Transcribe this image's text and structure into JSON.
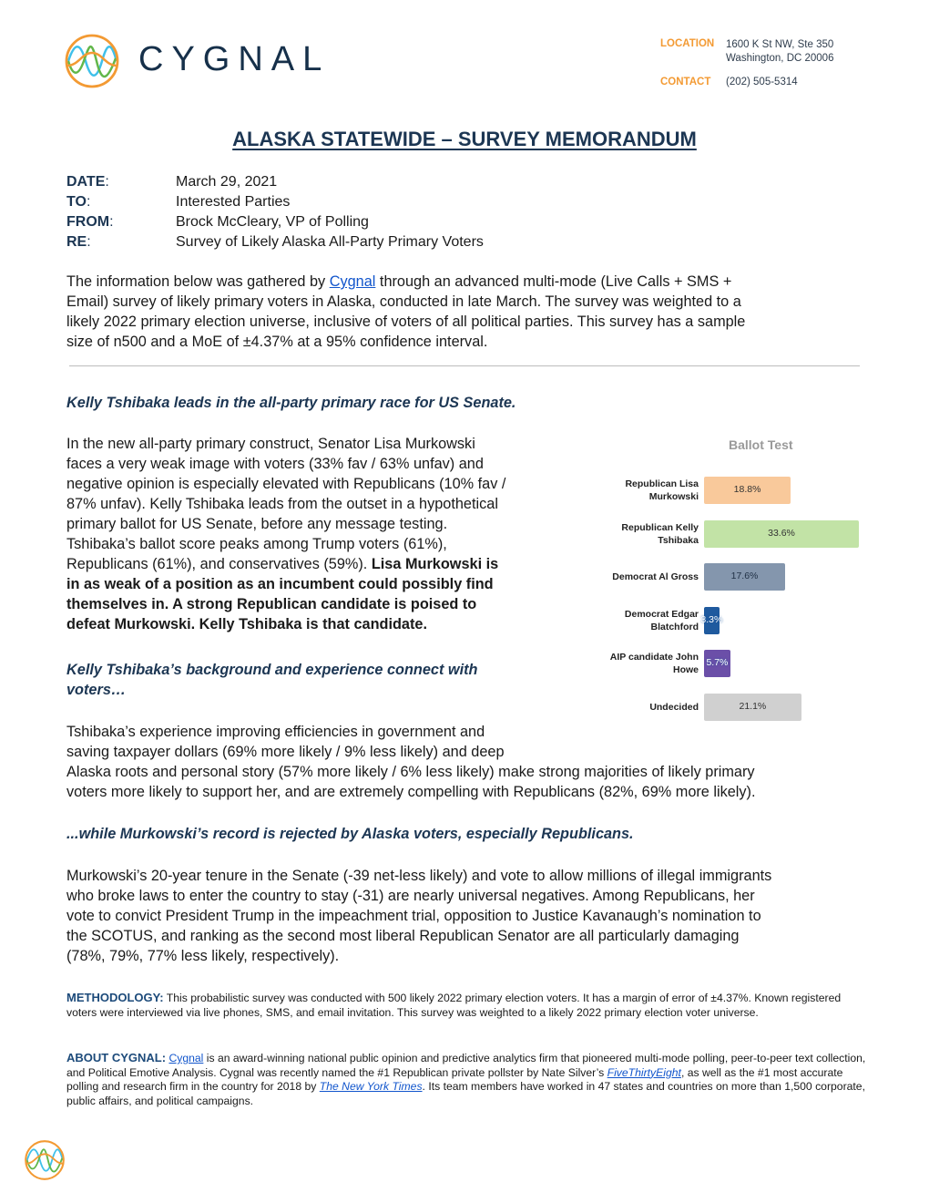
{
  "header": {
    "brand_name": "CYGNAL",
    "location_label": "LOCATION",
    "location_line1": "1600 K St NW, Ste 350",
    "location_line2": "Washington, DC 20006",
    "contact_label": "CONTACT",
    "contact_value": "(202) 505-5314",
    "colors": {
      "orange": "#f39a33",
      "navy": "#16304a",
      "green": "#62b74a",
      "cyan": "#3fc0ea"
    }
  },
  "title": "ALASKA STATEWIDE – SURVEY MEMORANDUM",
  "memo": [
    {
      "label": "DATE",
      "value": "March 29, 2021"
    },
    {
      "label": "TO",
      "value": "Interested Parties"
    },
    {
      "label": "FROM",
      "value": "Brock McCleary, VP of Polling"
    },
    {
      "label": "RE",
      "value": "Survey of Likely Alaska All-Party Primary Voters"
    }
  ],
  "intro": {
    "before_link": "The information below was gathered by ",
    "link_text": "Cygnal",
    "after_link_line1": " through an advanced multi-mode (Live Calls + SMS +",
    "line2": "Email) survey of likely primary voters in Alaska, conducted in late March. The survey was weighted to a",
    "line3": "likely 2022 primary election universe, inclusive of voters of all political parties. This survey has a sample",
    "line4": "size of n500 and a MoE of ±4.37% at a 95% confidence interval."
  },
  "section1": {
    "heading": "Kelly Tshibaka leads in the all-party primary race for US Senate.",
    "lines": [
      "In the new all-party primary construct, Senator Lisa Murkowski",
      "faces a very weak image with voters (33% fav / 63% unfav) and",
      "negative opinion is especially elevated with Republicans (10% fav /",
      "87% unfav). Kelly Tshibaka leads from the outset in a hypothetical",
      "primary ballot for US Senate, before any message testing.",
      "Tshibaka’s ballot score peaks among Trump voters (61%),"
    ],
    "line7_normal": "Republicans (61%), and conservatives (59%). ",
    "line7_bold": "Lisa Murkowski is",
    "bold_lines": [
      "in as weak of a position as an incumbent could possibly find",
      "themselves in. A strong Republican candidate is poised to",
      "defeat Murkowski. Kelly Tshibaka is that candidate."
    ]
  },
  "section2": {
    "heading_line1": "Kelly Tshibaka’s background and experience connect with",
    "heading_line2": "voters…",
    "lines": [
      "Tshibaka’s experience improving efficiencies in government and",
      "saving taxpayer dollars (69% more likely / 9% less likely) and deep",
      "Alaska roots and personal story (57% more likely / 6% less likely) make strong majorities of likely primary",
      "voters more likely to support her, and are extremely compelling with Republicans (82%, 69% more likely)."
    ]
  },
  "section3": {
    "heading": "...while Murkowski’s record is rejected by Alaska voters, especially Republicans.",
    "lines": [
      "Murkowski’s 20-year tenure in the Senate (-39 net-less likely) and vote to allow millions of illegal immigrants",
      "who broke laws to enter the country to stay (-31) are nearly universal negatives. Among Republicans, her",
      "vote to convict President Trump in the impeachment trial, opposition to Justice Kavanaugh’s nomination to",
      "the SCOTUS, and ranking as the second most liberal Republican Senator are all particularly damaging",
      "(78%, 79%, 77% less likely, respectively)."
    ]
  },
  "methodology": {
    "label": "METHODOLOGY:",
    "text": " This probabilistic survey was conducted with 500 likely 2022 primary election voters. It has a margin of error of ±4.37%. Known registered voters were interviewed via live phones, SMS, and email invitation. This survey was weighted to a likely 2022 primary election voter universe."
  },
  "about": {
    "label": "ABOUT CYGNAL:",
    "link1": "Cygnal",
    "text1": " is an award-winning national public opinion and predictive analytics firm that pioneered multi-mode polling, peer-to-peer text collection, and Political Emotive Analysis. Cygnal was recently named the #1 Republican private pollster by Nate Silver’s ",
    "link2": "FiveThirtyEight",
    "text2": ", as well as the #1 most accurate polling and research firm in the country for 2018 by ",
    "link3": "The New York Times",
    "text3": ". Its team members have worked in 47 states and countries on more than 1,500 corporate, public affairs, and political campaigns."
  },
  "chart_data": {
    "type": "bar",
    "orientation": "horizontal",
    "title": "Ballot Test",
    "categories": [
      "Republican Lisa Murkowski",
      "Republican Kelly Tshibaka",
      "Democrat Al Gross",
      "Democrat Edgar Blatchford",
      "AIP candidate John Howe",
      "Undecided"
    ],
    "category_lines": [
      [
        "Republican Lisa",
        "Murkowski"
      ],
      [
        "Republican Kelly",
        "Tshibaka"
      ],
      [
        "Democrat Al Gross"
      ],
      [
        "Democrat Edgar",
        "Blatchford"
      ],
      [
        "AIP candidate John",
        "Howe"
      ],
      [
        "Undecided"
      ]
    ],
    "values": [
      18.8,
      33.6,
      17.6,
      3.3,
      5.7,
      21.1
    ],
    "data_labels": [
      "18.8%",
      "33.6%",
      "17.6%",
      "3.3%",
      "5.7%",
      "21.1%"
    ],
    "colors": [
      "#f9c99b",
      "#c2e3a6",
      "#8496ad",
      "#1f5a9e",
      "#6b4fa8",
      "#d0d0d0"
    ],
    "label_colors": [
      "#333333",
      "#333333",
      "#1f2f44",
      "#ffffff",
      "#ffffff",
      "#333333"
    ],
    "xlim": [
      0,
      33.6
    ],
    "grid": false,
    "legend": "none",
    "xlabel": "",
    "ylabel": ""
  }
}
